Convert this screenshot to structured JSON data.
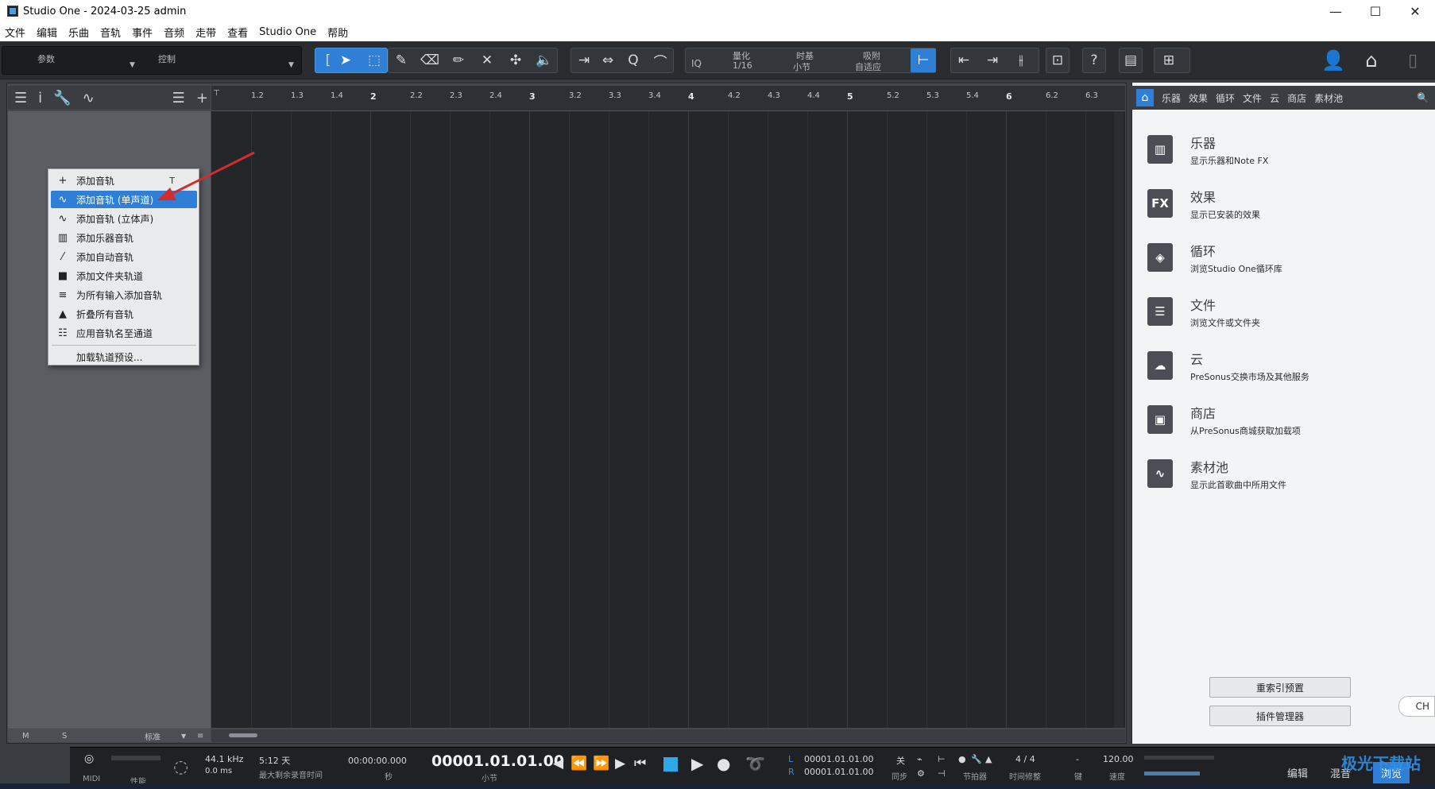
{
  "window": {
    "title": "Studio One - 2024-03-25 admin",
    "controls": [
      "—",
      "☐",
      "✕"
    ]
  },
  "menu": [
    "文件",
    "编辑",
    "乐曲",
    "音轨",
    "事件",
    "音频",
    "走带",
    "查看",
    "Studio One",
    "帮助"
  ],
  "toolbar": {
    "params_label": "参数",
    "control_label": "控制",
    "iq_label": "IQ",
    "quantize_label": "量化",
    "quantize_value": "1/16",
    "timebase_label": "时基",
    "timebase_value": "小节",
    "snap_label": "吸附",
    "snap_value": "自适应",
    "help_label": "?"
  },
  "ruler": {
    "ticks": [
      "1.2",
      "1.3",
      "1.4",
      "2",
      "2.2",
      "2.3",
      "2.4",
      "3",
      "3.2",
      "3.3",
      "3.4",
      "4",
      "4.2",
      "4.3",
      "4.4",
      "5",
      "5.2",
      "5.3",
      "5.4",
      "6",
      "6.2",
      "6.3"
    ]
  },
  "track_footer": {
    "m": "M",
    "s": "S",
    "std": "标准"
  },
  "context_menu": {
    "items": [
      {
        "icon": "+",
        "label": "添加音轨",
        "shortcut": "T",
        "selected": false
      },
      {
        "icon": "∿",
        "label": "添加音轨 (单声道)",
        "shortcut": "",
        "selected": true
      },
      {
        "icon": "∿",
        "label": "添加音轨 (立体声)",
        "shortcut": "",
        "selected": false
      },
      {
        "icon": "▥",
        "label": "添加乐器音轨",
        "shortcut": "",
        "selected": false
      },
      {
        "icon": "⁄",
        "label": "添加自动音轨",
        "shortcut": "",
        "selected": false
      },
      {
        "icon": "■",
        "label": "添加文件夹轨道",
        "shortcut": "",
        "selected": false
      },
      {
        "icon": "≡",
        "label": "为所有输入添加音轨",
        "shortcut": "",
        "selected": false
      },
      {
        "icon": "▲",
        "label": "折叠所有音轨",
        "shortcut": "",
        "selected": false
      },
      {
        "icon": "☷",
        "label": "应用音轨名至通道",
        "shortcut": "",
        "selected": false
      },
      {
        "icon": "",
        "label": "加载轨道预设...",
        "shortcut": "",
        "selected": false
      }
    ]
  },
  "browser": {
    "tabs": [
      "乐器",
      "效果",
      "循环",
      "文件",
      "云",
      "商店",
      "素材池"
    ],
    "items": [
      {
        "icon": "▥",
        "title": "乐器",
        "desc": "显示乐器和Note FX"
      },
      {
        "icon": "FX",
        "title": "效果",
        "desc": "显示已安装的效果"
      },
      {
        "icon": "◈",
        "title": "循环",
        "desc": "浏览Studio One循环库"
      },
      {
        "icon": "☰",
        "title": "文件",
        "desc": "浏览文件或文件夹"
      },
      {
        "icon": "☁",
        "title": "云",
        "desc": "PreSonus交换市场及其他服务"
      },
      {
        "icon": "▣",
        "title": "商店",
        "desc": "从PreSonus商城获取加载项"
      },
      {
        "icon": "∿",
        "title": "素材池",
        "desc": "显示此首歌曲中所用文件"
      }
    ],
    "reindex_btn": "重索引预置",
    "plugin_mgr_btn": "插件管理器"
  },
  "ime": "CH",
  "transport": {
    "midi": "MIDI",
    "perf": "性能",
    "sample_rate": "44.1 kHz",
    "latency": "0.0 ms",
    "rec_time": "5:12 天",
    "rec_time_label": "最大剩余录音时间",
    "seconds": "00:00:00.000",
    "seconds_label": "秒",
    "position": "00001.01.01.00",
    "position_label": "小节",
    "loop_l": "00001.01.01.00",
    "loop_r": "00001.01.01.00",
    "l": "L",
    "r": "R",
    "sync": "关",
    "sync_label": "同步",
    "metronome_label": "节拍器",
    "signature": "4 / 4",
    "signature_label": "时间修整",
    "key": "-",
    "key_label": "键",
    "tempo": "120.00",
    "tempo_label": "速度"
  },
  "bottom_tabs": [
    "编辑",
    "混音",
    "浏览"
  ],
  "watermark": "极光下载站"
}
